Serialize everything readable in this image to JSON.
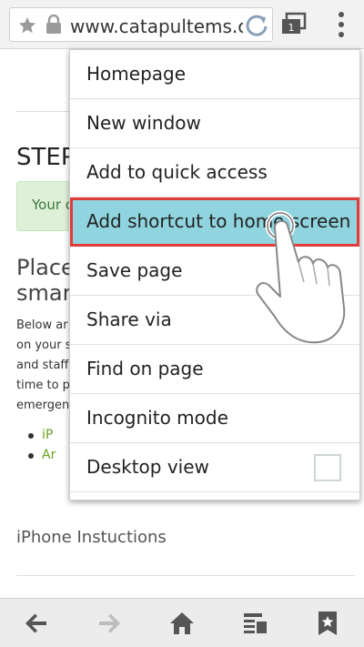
{
  "browser": {
    "url": "www.catapultems.cc"
  },
  "page": {
    "step_heading": "STEP",
    "alert_text": "Your c",
    "place_line1": "Place",
    "place_line2": "smar",
    "paragraph": [
      "Below ar",
      "on your s",
      "and staff",
      "time to p",
      "emergen"
    ],
    "links": [
      "iP",
      "Ar"
    ],
    "iphone_heading": "iPhone Instuctions"
  },
  "menu": {
    "items": [
      {
        "label": "Homepage"
      },
      {
        "label": "New window"
      },
      {
        "label": "Add to quick access"
      },
      {
        "label": "Add shortcut to home screen",
        "highlighted": true
      },
      {
        "label": "Save page"
      },
      {
        "label": "Share via"
      },
      {
        "label": "Find on page"
      },
      {
        "label": "Incognito mode"
      },
      {
        "label": "Desktop view",
        "checkbox": false
      }
    ]
  },
  "colors": {
    "highlight": "#8fd4de",
    "highlight_border": "#e23b3b",
    "alert_bg": "#dff0d8",
    "link": "#6aa121"
  }
}
